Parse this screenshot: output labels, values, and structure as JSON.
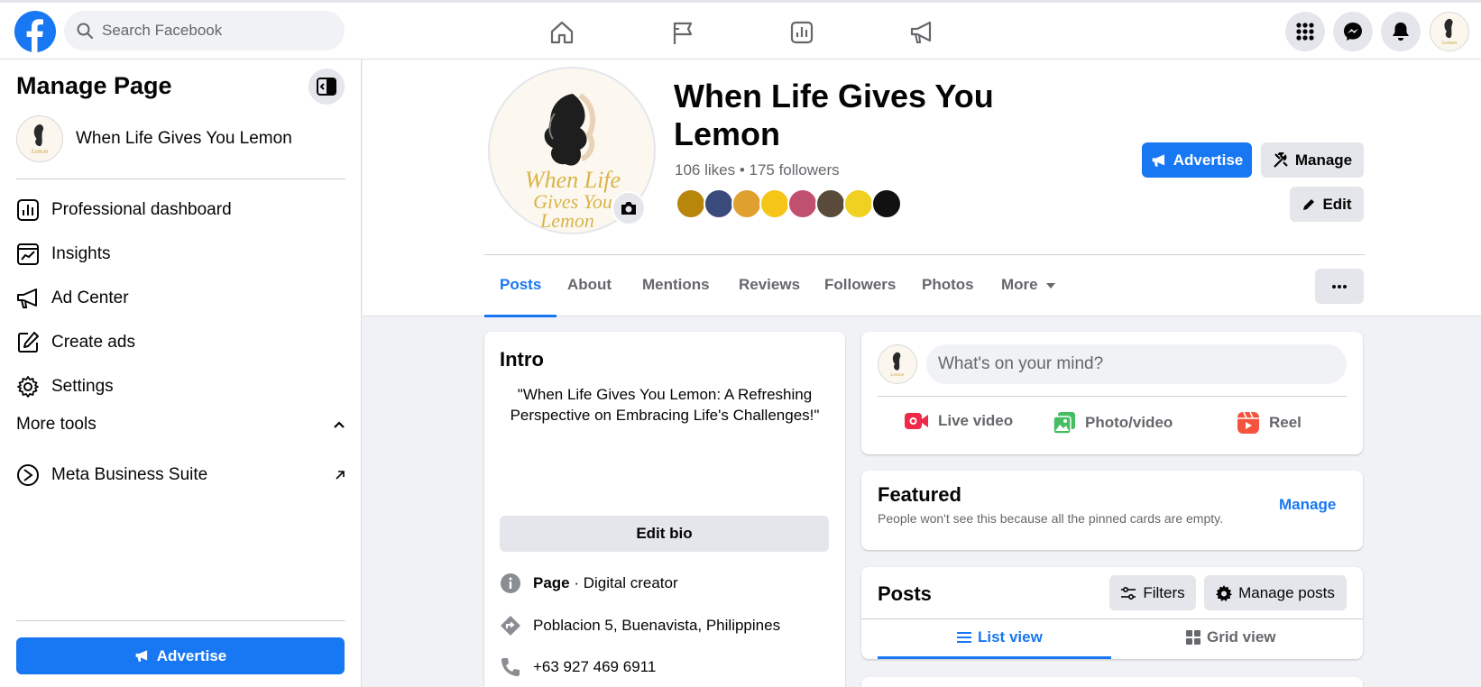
{
  "app": {
    "search_placeholder": "Search Facebook",
    "brand_color": "#1877f2",
    "nav_icons": [
      "home-icon",
      "flag-icon",
      "dashboard-icon",
      "megaphone-icon"
    ],
    "right_icons": [
      "menu-grid-icon",
      "messenger-icon",
      "notifications-icon",
      "account-avatar"
    ]
  },
  "sidebar": {
    "title": "Manage Page",
    "page_name": "When Life Gives You Lemon",
    "items": [
      {
        "label": "Professional dashboard",
        "icon": "dashboard-icon"
      },
      {
        "label": "Insights",
        "icon": "insights-icon"
      },
      {
        "label": "Ad Center",
        "icon": "megaphone-icon"
      },
      {
        "label": "Create ads",
        "icon": "edit-square-icon"
      },
      {
        "label": "Settings",
        "icon": "gear-icon"
      }
    ],
    "more_tools_label": "More tools",
    "more_tools_items": [
      {
        "label": "Meta Business Suite",
        "icon": "meta-business-suite-icon"
      }
    ],
    "advertise_label": "Advertise"
  },
  "profile": {
    "name": "When Life Gives You Lemon",
    "stats": "106 likes • 175 followers",
    "advertise_label": "Advertise",
    "manage_label": "Manage",
    "edit_label": "Edit",
    "tabs": [
      "Posts",
      "About",
      "Mentions",
      "Reviews",
      "Followers",
      "Photos",
      "More"
    ],
    "active_tab": "Posts"
  },
  "intro": {
    "title": "Intro",
    "bio": "\"When Life Gives You Lemon: A Refreshing Perspective on Embracing Life's Challenges!\"",
    "edit_bio_label": "Edit bio",
    "page_label": "Page",
    "category": " · Digital creator",
    "location": "Poblacion 5, Buenavista, Philippines",
    "phone": "+63 927 469 6911"
  },
  "composer": {
    "placeholder": "What's on your mind?",
    "live_label": "Live video",
    "photo_label": "Photo/video",
    "reel_label": "Reel"
  },
  "featured": {
    "title": "Featured",
    "subtitle": "People won't see this because all the pinned cards are empty.",
    "manage_label": "Manage"
  },
  "posts": {
    "title": "Posts",
    "filters_label": "Filters",
    "manage_label": "Manage posts",
    "list_view_label": "List view",
    "grid_view_label": "Grid view"
  }
}
